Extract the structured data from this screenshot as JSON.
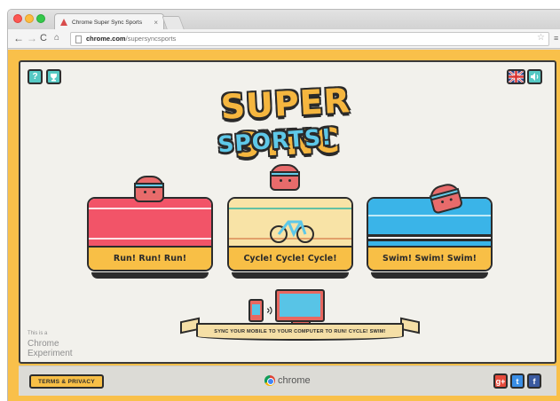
{
  "browser": {
    "tab_title": "Chrome Super Sync Sports",
    "tab_close": "×",
    "url_host": "chrome.com",
    "url_path": "/supersyncsports"
  },
  "nav": {
    "back": "←",
    "forward": "→",
    "reload": "C",
    "home": "⌂",
    "star": "☆",
    "menu": "≡"
  },
  "game": {
    "logo_line1": "SUPER SYNC",
    "logo_line2": "SPORTS!",
    "help_label": "?",
    "cards": [
      {
        "label": "Run! Run! Run!"
      },
      {
        "label": "Cycle! Cycle! Cycle!"
      },
      {
        "label": "Swim! Swim! Swim!"
      }
    ],
    "banner_text": "SYNC YOUR MOBILE TO YOUR COMPUTER TO RUN! CYCLE! SWIM!",
    "experiment_line1": "This is a",
    "experiment_line2": "Chrome",
    "experiment_line3": "Experiment"
  },
  "footer": {
    "terms_label": "TERMS & PRIVACY",
    "brand": "chrome",
    "gplus": "g+",
    "twitter": "t",
    "facebook": "f"
  },
  "colors": {
    "page_frame": "#f9c04a",
    "accent_teal": "#55c9c4",
    "run": "#f25468",
    "cycle": "#f8e3a6",
    "swim": "#3ab4e8"
  },
  "icons": {
    "help": "help-icon",
    "trophy": "trophy-icon",
    "language": "uk-flag-icon",
    "sound": "speaker-icon"
  }
}
